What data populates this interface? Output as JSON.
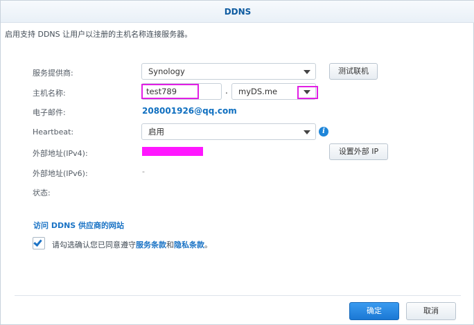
{
  "dialog": {
    "title": "DDNS"
  },
  "description": "启用支持 DDNS 让用户以注册的主机名称连接服务器。",
  "form": {
    "provider_label": "服务提供商:",
    "provider_value": "Synology",
    "test_button": "测试联机",
    "hostname_label": "主机名称:",
    "hostname_value": "test789",
    "hostname_dot": ".",
    "domain_value": "myDS.me",
    "email_label": "电子邮件:",
    "email_value": "208001926@qq.com",
    "heartbeat_label": "Heartbeat:",
    "heartbeat_value": "启用",
    "info_icon_glyph": "i",
    "ipv4_label": "外部地址(IPv4):",
    "ipv4_value": "",
    "set_ip_button": "设置外部 IP",
    "ipv6_label": "外部地址(IPv6):",
    "ipv6_value": "-",
    "status_label": "状态:"
  },
  "provider_link": "访问 DDNS 供应商的网站",
  "agreement": {
    "checked": true,
    "prefix": "请勾选确认您已同意遵守",
    "terms": "服务条款",
    "and": "和",
    "privacy": "隐私条款",
    "suffix": "。"
  },
  "footer": {
    "ok_button": "确定",
    "cancel_button": "取消"
  },
  "colors": {
    "accent": "#1b78d4",
    "link": "#1a73c5",
    "highlight": "#e11fe4",
    "redaction": "#ff17ff"
  }
}
